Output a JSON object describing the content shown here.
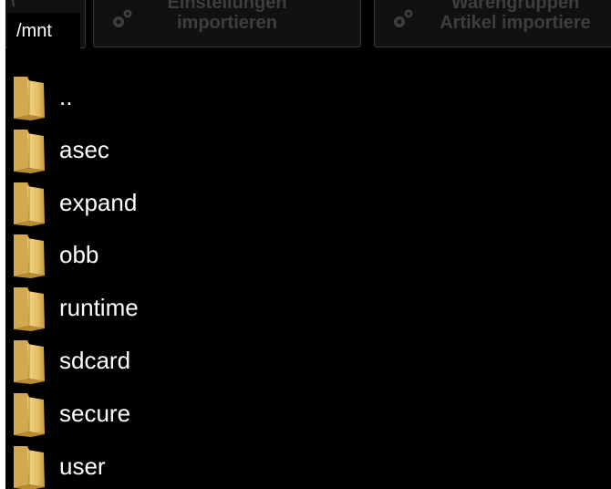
{
  "background_app": {
    "left_stub_char": "\\",
    "buttons": [
      {
        "line1": "Einstellungen",
        "line2": "importieren",
        "icon": "gear-icon"
      },
      {
        "line1": "Warengruppen",
        "line2": "Artikel importiere",
        "icon": "gear-icon"
      }
    ]
  },
  "file_browser": {
    "current_path": "/mnt",
    "entries": [
      {
        "name": "..",
        "icon": "folder-icon"
      },
      {
        "name": "asec",
        "icon": "folder-icon"
      },
      {
        "name": "expand",
        "icon": "folder-icon"
      },
      {
        "name": "obb",
        "icon": "folder-icon"
      },
      {
        "name": "runtime",
        "icon": "folder-icon"
      },
      {
        "name": "sdcard",
        "icon": "folder-icon"
      },
      {
        "name": "secure",
        "icon": "folder-icon"
      },
      {
        "name": "user",
        "icon": "folder-icon"
      }
    ]
  },
  "colors": {
    "background": "#000000",
    "text": "#ffffff",
    "folder": "#e8c26a",
    "muted_button_text": "#3e3e3e"
  }
}
